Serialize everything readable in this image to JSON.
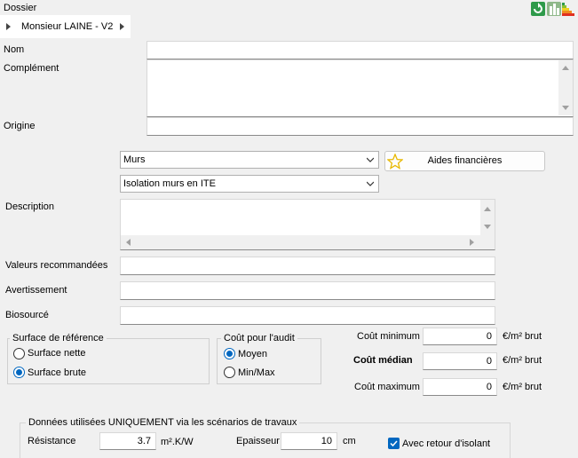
{
  "dossier": {
    "label": "Dossier",
    "breadcrumb": "Monsieur LAINE - V2"
  },
  "header_icons": [
    "recycle-icon",
    "buildings-icon",
    "energy-label-icon"
  ],
  "fields": {
    "nom": "Nom",
    "complement": "Complément",
    "origine": "Origine",
    "description": "Description",
    "valeurs": "Valeurs recommandées",
    "avertissement": "Avertissement",
    "biosource": "Biosourcé"
  },
  "selects": {
    "category": "Murs",
    "work": "Isolation murs en ITE"
  },
  "aides_button": "Aides financières",
  "surface": {
    "title": "Surface de référence",
    "nette": "Surface nette",
    "brute": "Surface brute",
    "selected": "brute"
  },
  "cout_audit": {
    "title": "Coût pour l'audit",
    "moyen": "Moyen",
    "minmax": "Min/Max",
    "selected": "moyen"
  },
  "costs": [
    {
      "label": "Coût minimum",
      "value": "0",
      "unit": "€/m² brut"
    },
    {
      "label": "Coût médian",
      "value": "0",
      "unit": "€/m² brut"
    },
    {
      "label": "Coût maximum",
      "value": "0",
      "unit": "€/m² brut"
    }
  ],
  "scenarios": {
    "title": "Données utilisées UNIQUEMENT via les scénarios de travaux",
    "resistance_label": "Résistance",
    "resistance_value": "3.7",
    "resistance_unit": "m².K/W",
    "epaisseur_label": "Epaisseur",
    "epaisseur_value": "10",
    "epaisseur_unit": "cm",
    "retour_label": "Avec retour d'isolant",
    "retour_checked": true
  },
  "colors": {
    "accent": "#0067c0",
    "icon_green": "#2e9a4a",
    "energy_red": "#e03020"
  }
}
